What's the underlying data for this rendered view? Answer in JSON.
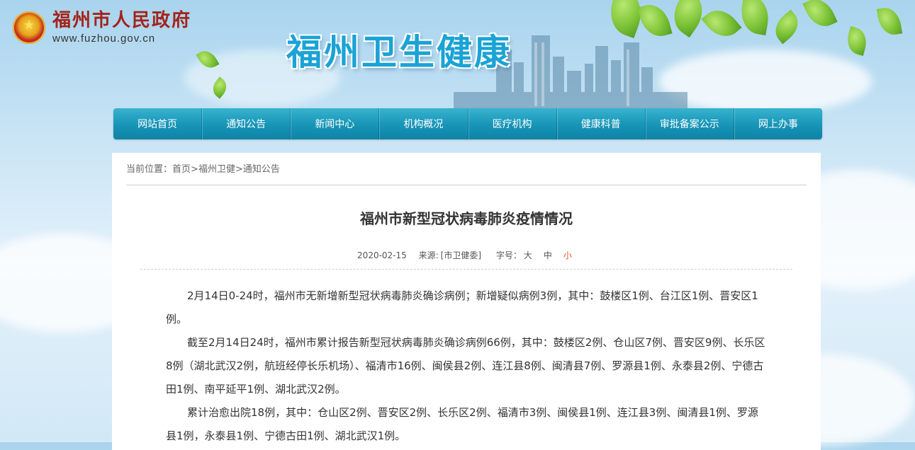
{
  "header": {
    "gov_title": "福州市人民政府",
    "gov_url": "www.fuzhou.gov.cn",
    "site_title": "福州卫生健康"
  },
  "nav": {
    "items": [
      "网站首页",
      "通知公告",
      "新闻中心",
      "机构概况",
      "医疗机构",
      "健康科普",
      "审批备案公示",
      "网上办事"
    ]
  },
  "breadcrumb": {
    "prefix": "当前位置：",
    "items": [
      "首页",
      "福州卫健",
      "通知公告"
    ],
    "separator": ">"
  },
  "article": {
    "title": "福州市新型冠状病毒肺炎疫情情况",
    "date": "2020-02-15",
    "source_label": "来源:",
    "source": "[市卫健委]",
    "font_label": "字号：",
    "font_sizes": [
      "大",
      "中",
      "小"
    ],
    "paragraphs": [
      "2月14日0-24时，福州市无新增新型冠状病毒肺炎确诊病例；新增疑似病例3例，其中：鼓楼区1例、台江区1例、晋安区1例。",
      "截至2月14日24时，福州市累计报告新型冠状病毒肺炎确诊病例66例，其中：鼓楼区2例、仓山区7例、晋安区9例、长乐区8例（湖北武汉2例，航班经停长乐机场）、福清市16例、闽侯县2例、连江县8例、闽清县7例、罗源县1例、永泰县2例、宁德古田1例、南平延平1例、湖北武汉2例。",
      "累计治愈出院18例，其中：仓山区2例、晋安区2例、长乐区2例、福清市3例、闽侯县1例、连江县3例、闽清县1例、罗源县1例，永泰县1例、宁德古田1例、湖北武汉1例。"
    ]
  },
  "colors": {
    "gov_title": "#a3241b",
    "site_title": "#1aa3d6",
    "nav_bg": "#1694b6",
    "active_font_size": "#e05a1c"
  }
}
